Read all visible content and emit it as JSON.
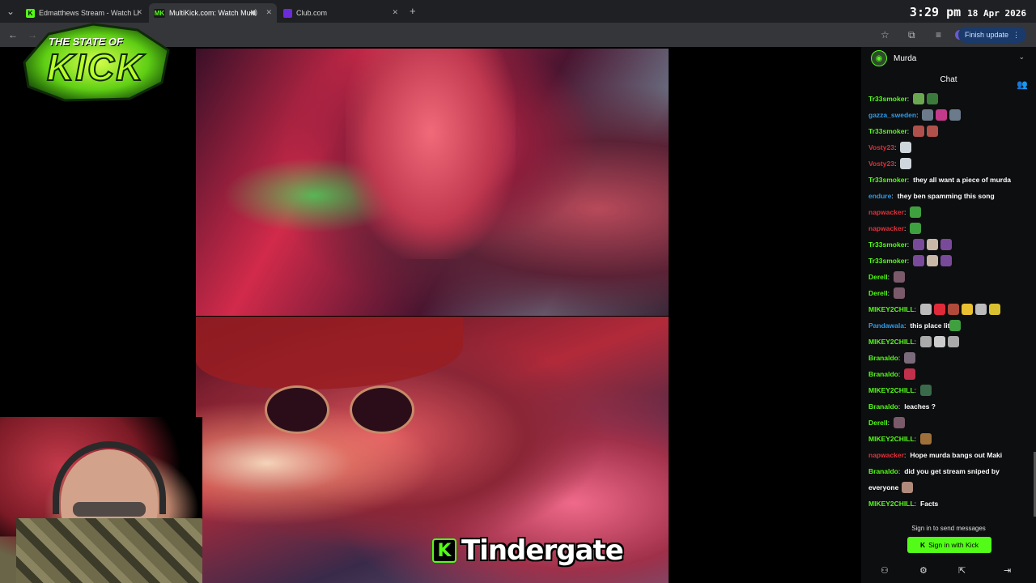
{
  "browser": {
    "tabs": [
      {
        "label": "Edmatthews Stream - Watch Li",
        "favicon": "K",
        "color": "#53fc18"
      },
      {
        "label": "MultiKick.com: Watch Multi",
        "favicon": "MK",
        "color": "#53fc18"
      },
      {
        "label": "Club.com",
        "favicon": "",
        "color": "#6c2bd9"
      }
    ],
    "finish_update": "Finish update",
    "time": "3:29 pm",
    "date": "18 Apr 2026"
  },
  "overlay": {
    "logo_top": "THE STATE OF",
    "logo_main": "KICK",
    "caption_badge": "K",
    "caption": "Tindergate"
  },
  "chat": {
    "channel": "Murda",
    "title": "Chat",
    "messages": [
      {
        "user": "Tr33smoker",
        "color": "#53fc18",
        "text": "",
        "emotes": [
          "#6aa84f",
          "#3a7a3a"
        ]
      },
      {
        "user": "gazza_sweden",
        "color": "#2f9be8",
        "text": "",
        "emotes": [
          "#6b7b8b",
          "#c33a8a",
          "#6b7b8b"
        ]
      },
      {
        "user": "Tr33smoker",
        "color": "#53fc18",
        "text": "",
        "emotes": [
          "#b0504a",
          "#b0504a"
        ]
      },
      {
        "user": "Vosty23",
        "color": "#e0313a",
        "text": "",
        "emotes": [
          "#cfd6dc"
        ]
      },
      {
        "user": "Vosty23",
        "color": "#e0313a",
        "text": "",
        "emotes": [
          "#cfd6dc"
        ]
      },
      {
        "user": "Tr33smoker",
        "color": "#53fc18",
        "text": "they all want a piece of murda",
        "emotes": []
      },
      {
        "user": "endure",
        "color": "#2f9be8",
        "text": "they ben spamming this song",
        "emotes": []
      },
      {
        "user": "napwacker",
        "color": "#e0313a",
        "text": "",
        "emotes": [
          "#3fa03f"
        ]
      },
      {
        "user": "napwacker",
        "color": "#e0313a",
        "text": "",
        "emotes": [
          "#3fa03f"
        ]
      },
      {
        "user": "Tr33smoker",
        "color": "#53fc18",
        "text": "",
        "emotes": [
          "#7a4a9a",
          "#c8b8a8",
          "#7a4a9a"
        ]
      },
      {
        "user": "Tr33smoker",
        "color": "#53fc18",
        "text": "",
        "emotes": [
          "#7a4a9a",
          "#c8b8a8",
          "#7a4a9a"
        ]
      },
      {
        "user": "Derell",
        "color": "#53fc18",
        "text": "",
        "emotes": [
          "#7a5a6a"
        ]
      },
      {
        "user": "Derell",
        "color": "#53fc18",
        "text": "",
        "emotes": [
          "#7a5a6a"
        ]
      },
      {
        "user": "MIKEY2CHILL",
        "color": "#53fc18",
        "text": "",
        "emotes": [
          "#bbb",
          "#e02a3a",
          "#b04a3a",
          "#e8c030",
          "#bbb",
          "#d8c030"
        ]
      },
      {
        "user": "Pandawala",
        "color": "#2f9be8",
        "text": "this place lit",
        "emotes": [
          "#3fa03f"
        ]
      },
      {
        "user": "MIKEY2CHILL",
        "color": "#53fc18",
        "text": "",
        "emotes": [
          "#aaa",
          "#ccc",
          "#aaa"
        ]
      },
      {
        "user": "Branaldo",
        "color": "#53fc18",
        "text": "",
        "emotes": [
          "#7a6a7a"
        ]
      },
      {
        "user": "Branaldo",
        "color": "#53fc18",
        "text": "",
        "emotes": [
          "#c0304a"
        ]
      },
      {
        "user": "MIKEY2CHILL",
        "color": "#53fc18",
        "text": "",
        "emotes": [
          "#3a6a4a"
        ]
      },
      {
        "user": "Branaldo",
        "color": "#53fc18",
        "text": "leaches ?",
        "emotes": []
      },
      {
        "user": "Derell",
        "color": "#53fc18",
        "text": "",
        "emotes": [
          "#7a5a6a"
        ]
      },
      {
        "user": "MIKEY2CHILL",
        "color": "#53fc18",
        "text": "",
        "emotes": [
          "#a0703a"
        ]
      },
      {
        "user": "napwacker",
        "color": "#e0313a",
        "text": "Hope murda bangs out Maki",
        "emotes": []
      },
      {
        "user": "Branaldo",
        "color": "#53fc18",
        "text": "did you get stream sniped by",
        "emotes": []
      },
      {
        "user": "everyone",
        "color": "#fff",
        "text": "",
        "emotes": [
          "#b08a7a"
        ]
      },
      {
        "user": "MIKEY2CHILL",
        "color": "#53fc18",
        "text": "Facts",
        "emotes": []
      }
    ],
    "sign_in_hint": "Sign in to send messages",
    "sign_in_button": "Sign in with Kick"
  }
}
